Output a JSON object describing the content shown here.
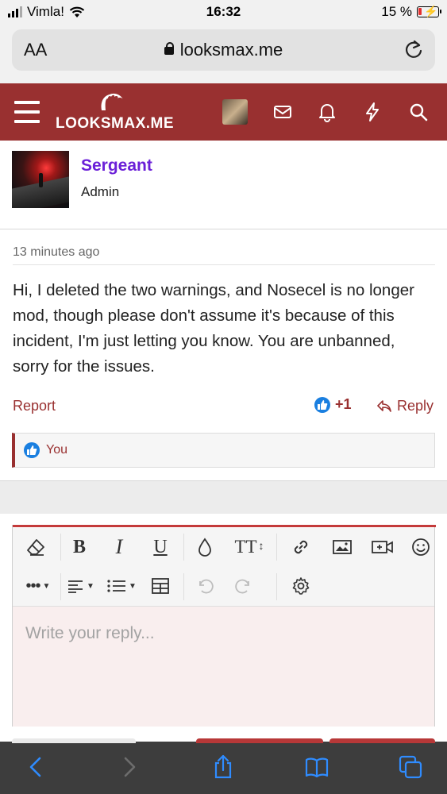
{
  "status_bar": {
    "carrier": "Vimla!",
    "time": "16:32",
    "battery": "15 %"
  },
  "browser": {
    "aa_label": "AA",
    "url": "looksmax.me",
    "reload_icon": "reload-icon"
  },
  "site_header": {
    "logo_text": "LOOKSMAX.ME",
    "icons": [
      "menu-icon",
      "user-avatar",
      "inbox-icon",
      "alerts-bell-icon",
      "whats-new-lightning-icon",
      "search-icon"
    ],
    "background_color": "#993030"
  },
  "post": {
    "author": {
      "name": "Sergeant",
      "title": "Admin",
      "name_color": "#6b1fd8"
    },
    "time": "13 minutes ago",
    "message": "Hi, I deleted the two warnings, and Nosecel is no longer mod, though please don't assume it's because of this incident, I'm just letting you know. You are unbanned, sorry for the issues.",
    "actions": {
      "report": "Report",
      "reaction_count": "+1",
      "reply": "Reply"
    },
    "reactions": {
      "who": "You"
    }
  },
  "editor": {
    "placeholder": "Write your reply...",
    "toolbar_row1": [
      "eraser-icon",
      "bold",
      "italic",
      "underline",
      "text-color-drop-icon",
      "font-size",
      "link-icon",
      "image-icon",
      "video-icon",
      "smiley-icon"
    ],
    "toolbar_row2": [
      "more-options",
      "align",
      "list",
      "table-icon",
      "undo-icon",
      "redo-icon",
      "settings-gear-icon"
    ],
    "bold_glyph": "B",
    "italic_glyph": "I",
    "underline_glyph": "U",
    "font_size_glyph": "TT"
  },
  "safari_toolbar": {
    "icons": [
      "back-icon",
      "forward-icon",
      "share-icon",
      "bookmarks-icon",
      "tabs-icon"
    ]
  }
}
